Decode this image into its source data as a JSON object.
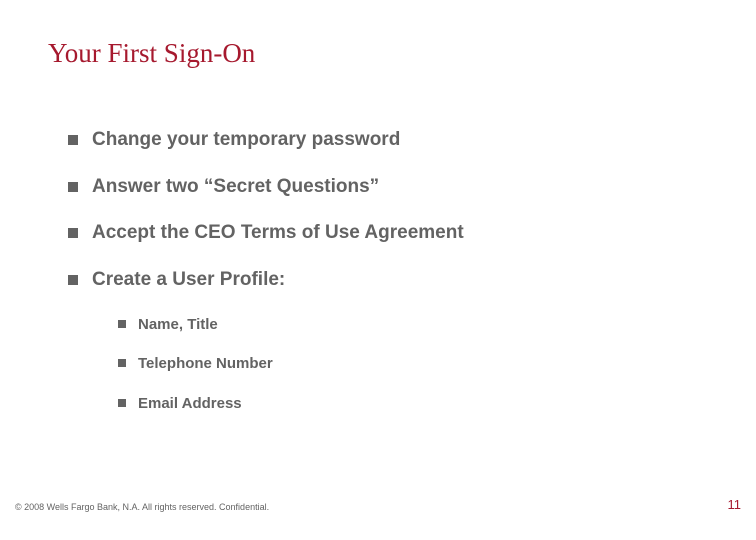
{
  "title": "Your First Sign-On",
  "bullets": {
    "item1": "Change your temporary password",
    "item2": "Answer two “Secret Questions”",
    "item3": "Accept the CEO Terms of Use Agreement",
    "item4": "Create a User Profile:"
  },
  "sub_bullets": {
    "sub1": "Name, Title",
    "sub2": "Telephone Number",
    "sub3": "Email Address"
  },
  "footer": {
    "copyright": "© 2008 Wells Fargo Bank, N.A. All rights reserved.  Confidential.",
    "page_number": "11"
  }
}
